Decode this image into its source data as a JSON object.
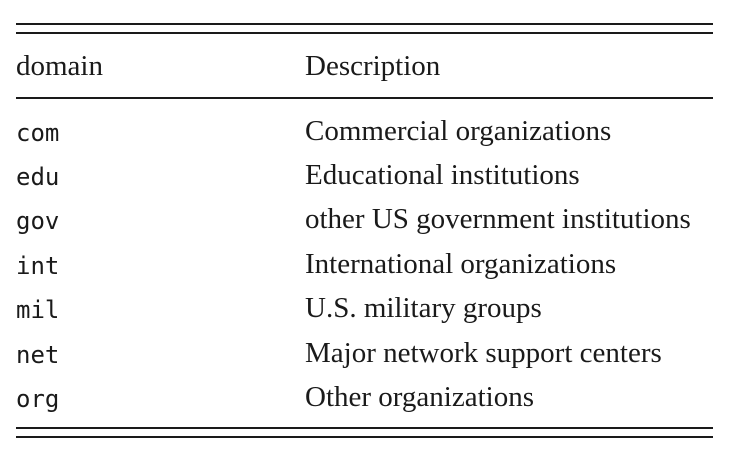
{
  "table": {
    "headers": {
      "domain": "domain",
      "description": "Description"
    },
    "rows": [
      {
        "domain": "com",
        "description": "Commercial organizations"
      },
      {
        "domain": "edu",
        "description": "Educational institutions"
      },
      {
        "domain": "gov",
        "description": "other US government institutions"
      },
      {
        "domain": "int",
        "description": "International organizations"
      },
      {
        "domain": "mil",
        "description": "U.S. military groups"
      },
      {
        "domain": "net",
        "description": "Major network support centers"
      },
      {
        "domain": "org",
        "description": "Other organizations"
      }
    ]
  }
}
